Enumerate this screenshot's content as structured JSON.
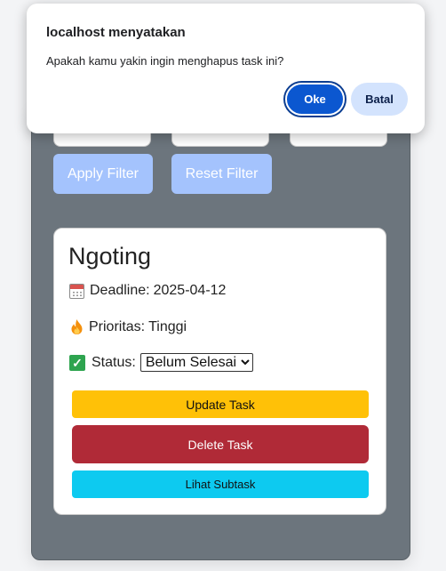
{
  "dialog": {
    "title": "localhost menyatakan",
    "message": "Apakah kamu yakin ingin menghapus task ini?",
    "ok_label": "Oke",
    "cancel_label": "Batal"
  },
  "filters": {
    "apply_label": "Apply Filter",
    "reset_label": "Reset Filter"
  },
  "task": {
    "title": "Ngoting",
    "deadline_label": "Deadline:",
    "deadline_value": "2025-04-12",
    "priority_label": "Prioritas:",
    "priority_value": "Tinggi",
    "status_label": "Status:",
    "status_selected": "Belum Selesai",
    "update_label": "Update Task",
    "delete_label": "Delete Task",
    "subtask_label": "Lihat Subtask"
  },
  "icons": {
    "deadline": "calendar-icon",
    "priority": "fire-icon",
    "status": "check-mark-icon"
  },
  "colors": {
    "panel_bg": "#6c757d",
    "filter_button": "#a4c3fd",
    "update_button": "#ffc107",
    "delete_button": "#b02a37",
    "subtask_button": "#0dcaf0",
    "dialog_ok": "#0b57d0",
    "dialog_cancel": "#d3e3fd"
  }
}
